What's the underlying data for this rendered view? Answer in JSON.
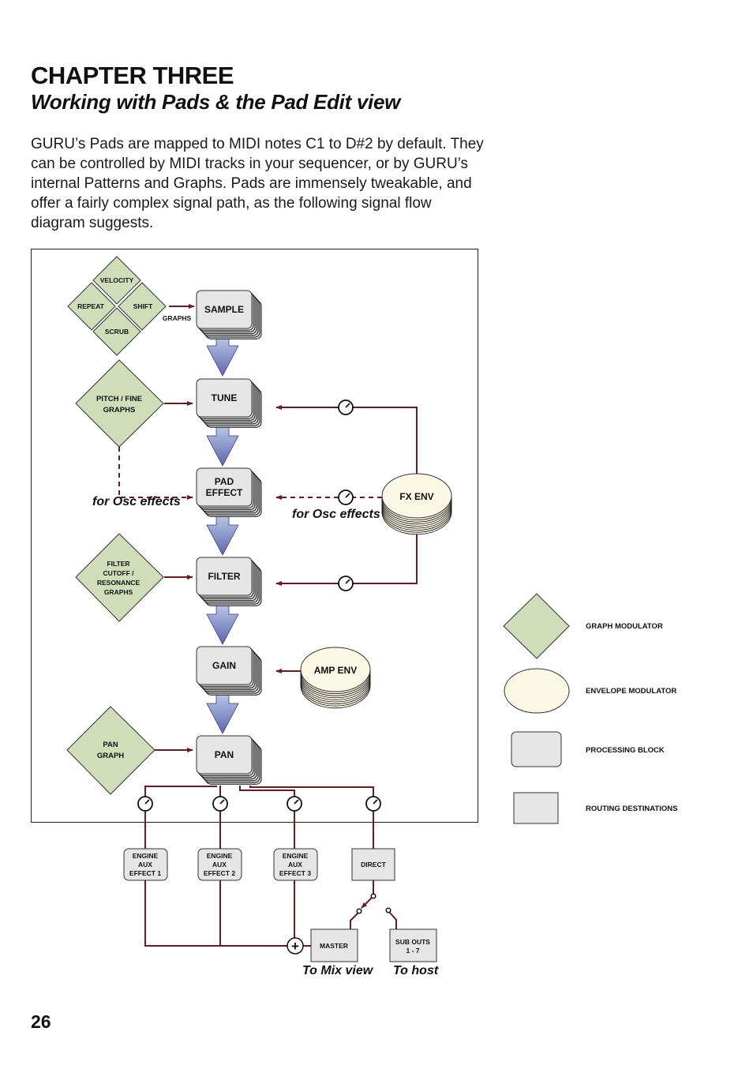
{
  "header": {
    "chapter": "CHAPTER THREE",
    "subtitle": "Working with Pads & the Pad Edit view"
  },
  "intro": "GURU’s Pads are mapped to MIDI notes C1 to D#2 by default. They can be controlled by MIDI tracks in your sequencer, or by GURU’s internal Patterns and Graphs. Pads are immensely tweakable, and offer a fairly complex signal path, as the following signal flow diagram suggests.",
  "page_number": "26",
  "colors": {
    "graph_modulator": "#cfddb9",
    "envelope_modulator": "#fdf8e6",
    "processing_block": "#e6e6e6",
    "routing": "#e6e6e6",
    "signal_line": "#6b1a22",
    "flow_arrow_top": "#c3d2ee",
    "flow_arrow_bottom": "#6a72b4"
  },
  "diagram": {
    "graph_cluster": {
      "velocity": "VELOCITY",
      "repeat": "REPEAT",
      "shift": "SHIFT",
      "scrub": "SCRUB",
      "arrow_label": "GRAPHS"
    },
    "modulators": {
      "pitch_fine": [
        "PITCH / FINE",
        "GRAPHS"
      ],
      "filter_graphs": [
        "FILTER",
        "CUTOFF /",
        "RESONANCE",
        "GRAPHS"
      ],
      "pan_graph": [
        "PAN",
        "GRAPH"
      ]
    },
    "blocks": {
      "sample": [
        "SAMPLE"
      ],
      "tune": [
        "TUNE"
      ],
      "pad_effect": [
        "PAD",
        "EFFECT"
      ],
      "filter": [
        "FILTER"
      ],
      "gain": [
        "GAIN"
      ],
      "pan": [
        "PAN"
      ]
    },
    "envelopes": {
      "fx_env": "FX ENV",
      "amp_env": "AMP ENV"
    },
    "notes": {
      "osc_left": "for Osc effects",
      "osc_right": "for Osc effects",
      "to_mix": "To Mix view",
      "to_host": "To host"
    },
    "destinations": {
      "aux1": [
        "ENGINE",
        "AUX",
        "EFFECT 1"
      ],
      "aux2": [
        "ENGINE",
        "AUX",
        "EFFECT 2"
      ],
      "aux3": [
        "ENGINE",
        "AUX",
        "EFFECT 3"
      ],
      "direct": [
        "DIRECT"
      ],
      "master": [
        "MASTER"
      ],
      "sub_outs": [
        "SUB OUTS",
        "1 - 7"
      ]
    },
    "sum_symbol": "+"
  },
  "legend": [
    {
      "shape": "diamond",
      "label": "GRAPH MODULATOR"
    },
    {
      "shape": "ellipse",
      "label": "ENVELOPE MODULATOR"
    },
    {
      "shape": "rounded-rect",
      "label": "PROCESSING BLOCK"
    },
    {
      "shape": "rect",
      "label": "ROUTING DESTINATIONS"
    }
  ]
}
